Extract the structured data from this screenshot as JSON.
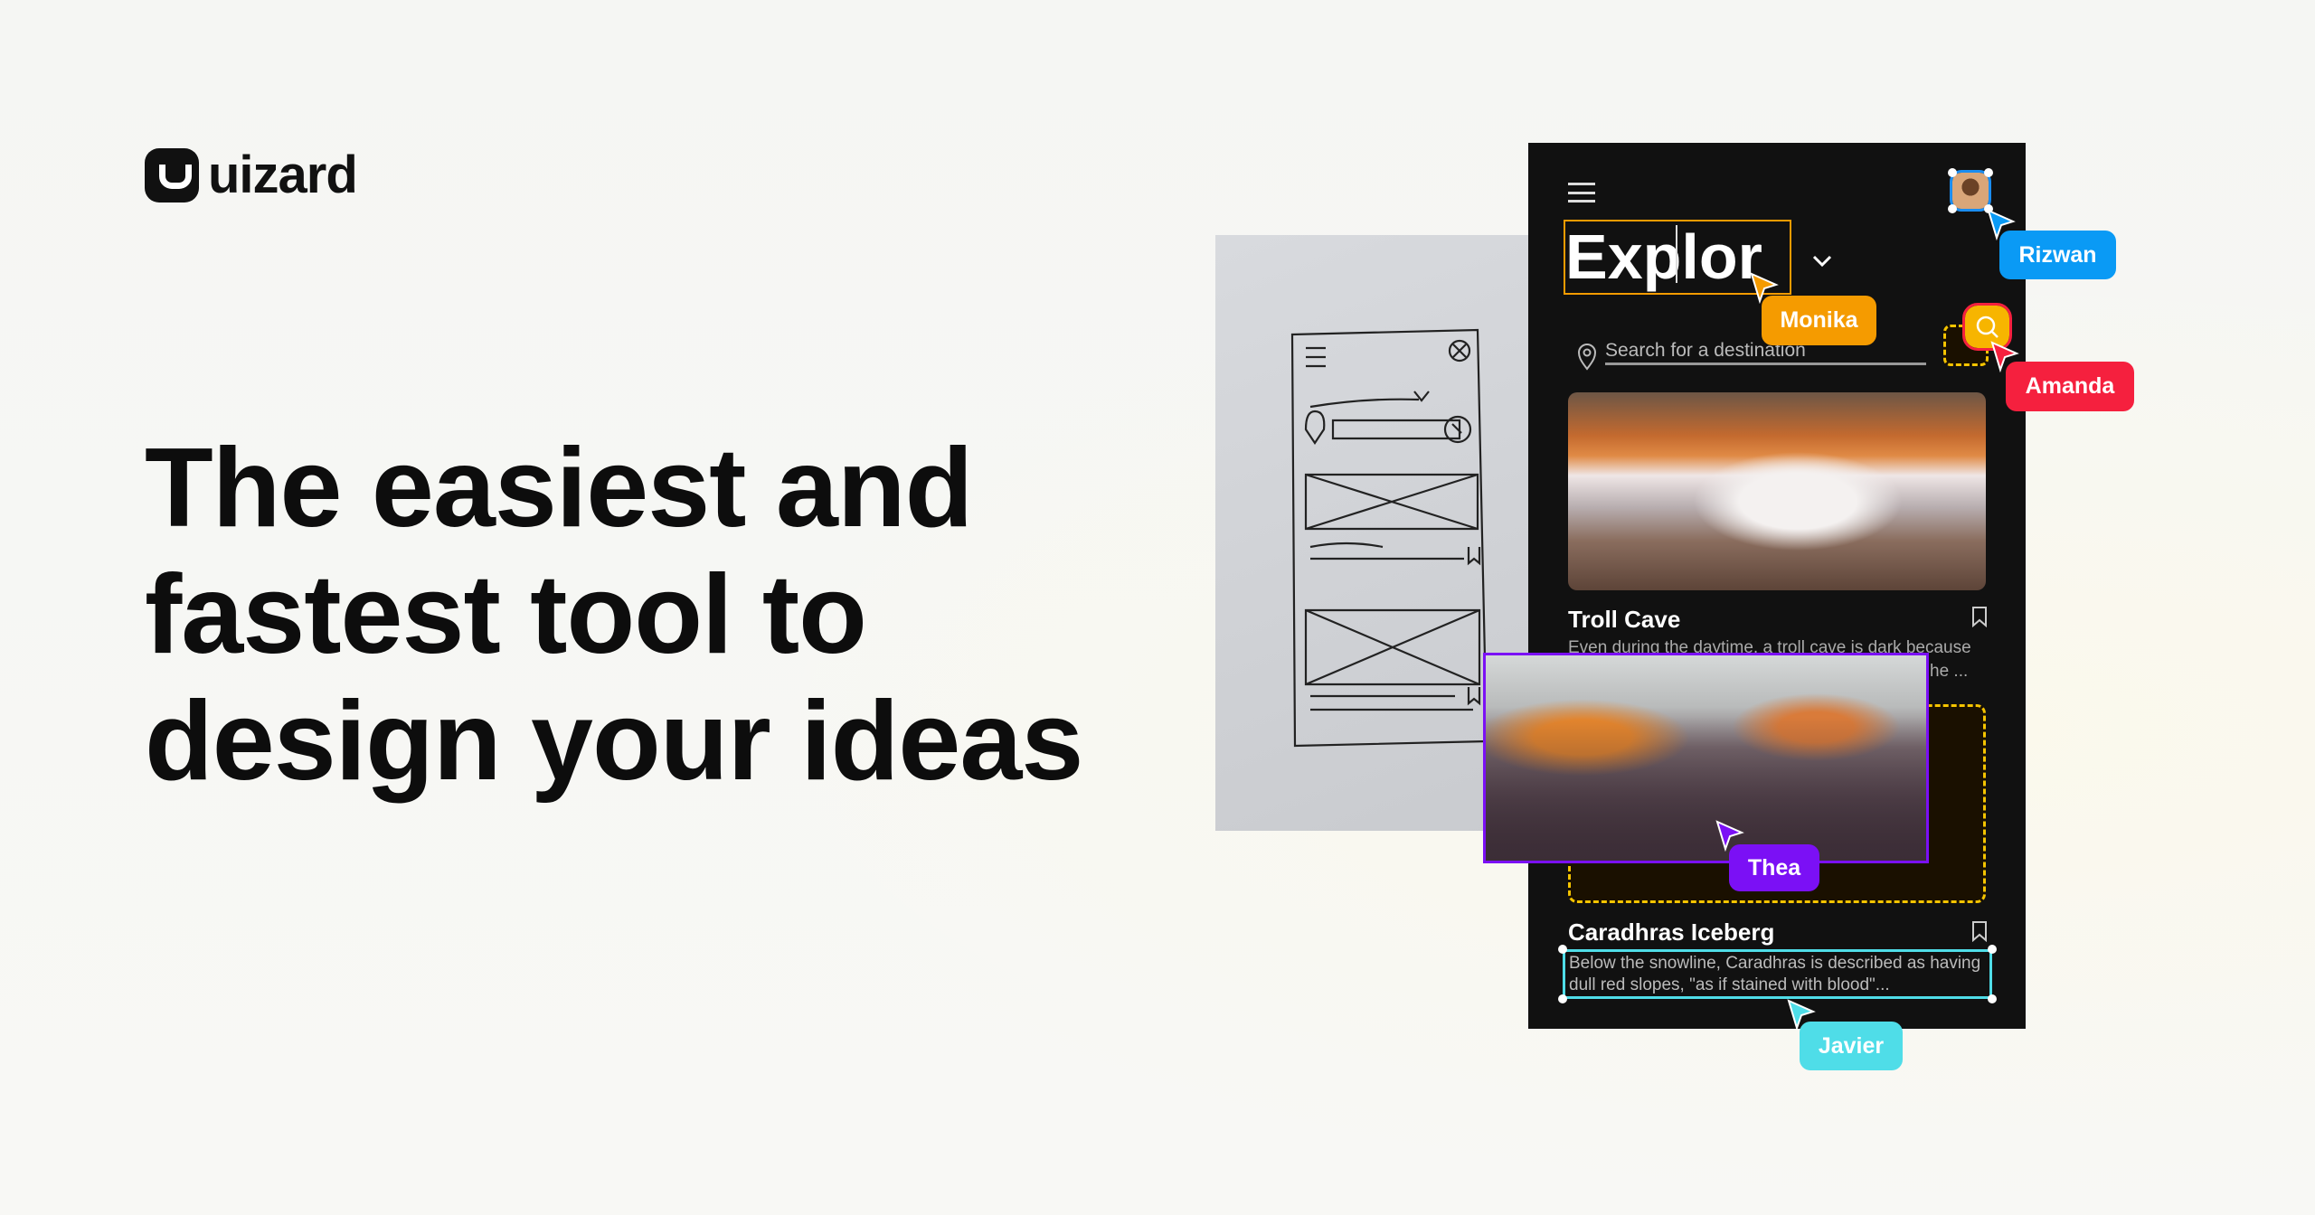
{
  "brand": {
    "name": "uizard"
  },
  "headline": {
    "lines": [
      "The easiest and",
      "fastest tool to",
      "design your ideas"
    ]
  },
  "mockup": {
    "title": "Explor",
    "search_placeholder": "Search for a destination",
    "cards": [
      {
        "title": "Troll Cave",
        "description_lines": [
          "Even during the daytime, a troll cave is dark because",
          "he ..."
        ]
      },
      {
        "title": "Caradhras Iceberg",
        "description_lines": [
          "Below the snowline, Caradhras is described as having",
          "dull red slopes, \"as if stained with blood\"..."
        ]
      }
    ]
  },
  "collaborators": [
    {
      "name": "Rizwan",
      "color": "#0a9af5"
    },
    {
      "name": "Monika",
      "color": "#f59b00"
    },
    {
      "name": "Amanda",
      "color": "#f5203e"
    },
    {
      "name": "Thea",
      "color": "#7b10f5"
    },
    {
      "name": "Javier",
      "color": "#4fdde8"
    }
  ],
  "icons": [
    "menu-icon",
    "chevron-down-icon",
    "location-pin-icon",
    "search-icon",
    "bookmark-icon",
    "cursor-icon"
  ]
}
